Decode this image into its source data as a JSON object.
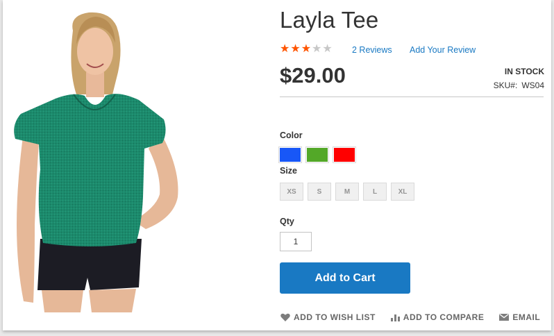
{
  "product": {
    "name": "Layla Tee",
    "rating": {
      "stars_filled": 3,
      "stars_total": 5
    },
    "reviews_link": "2 Reviews",
    "add_review_link": "Add Your Review",
    "price": "$29.00",
    "stock_status": "In stock",
    "sku_label": "SKU#:",
    "sku_value": "WS04"
  },
  "options": {
    "color_label": "Color",
    "colors": [
      {
        "name": "blue-swatch",
        "hex": "#1857f7"
      },
      {
        "name": "green-swatch",
        "hex": "#53a828"
      },
      {
        "name": "red-swatch",
        "hex": "#ff0000"
      }
    ],
    "size_label": "Size",
    "sizes": [
      "XS",
      "S",
      "M",
      "L",
      "XL"
    ]
  },
  "quantity": {
    "label": "Qty",
    "value": "1"
  },
  "add_to_cart_label": "Add to Cart",
  "actions": {
    "wish_list": "Add to Wish List",
    "compare": "Add to Compare",
    "email": "Email"
  },
  "icons": {
    "wish_list": "heart-icon",
    "compare": "bar-chart-icon",
    "email": "envelope-icon",
    "star": "star-icon"
  },
  "colors": {
    "link": "#1979c3",
    "button": "#1979c3",
    "star_on": "#ff5501",
    "star_off": "#c7c7c7"
  }
}
